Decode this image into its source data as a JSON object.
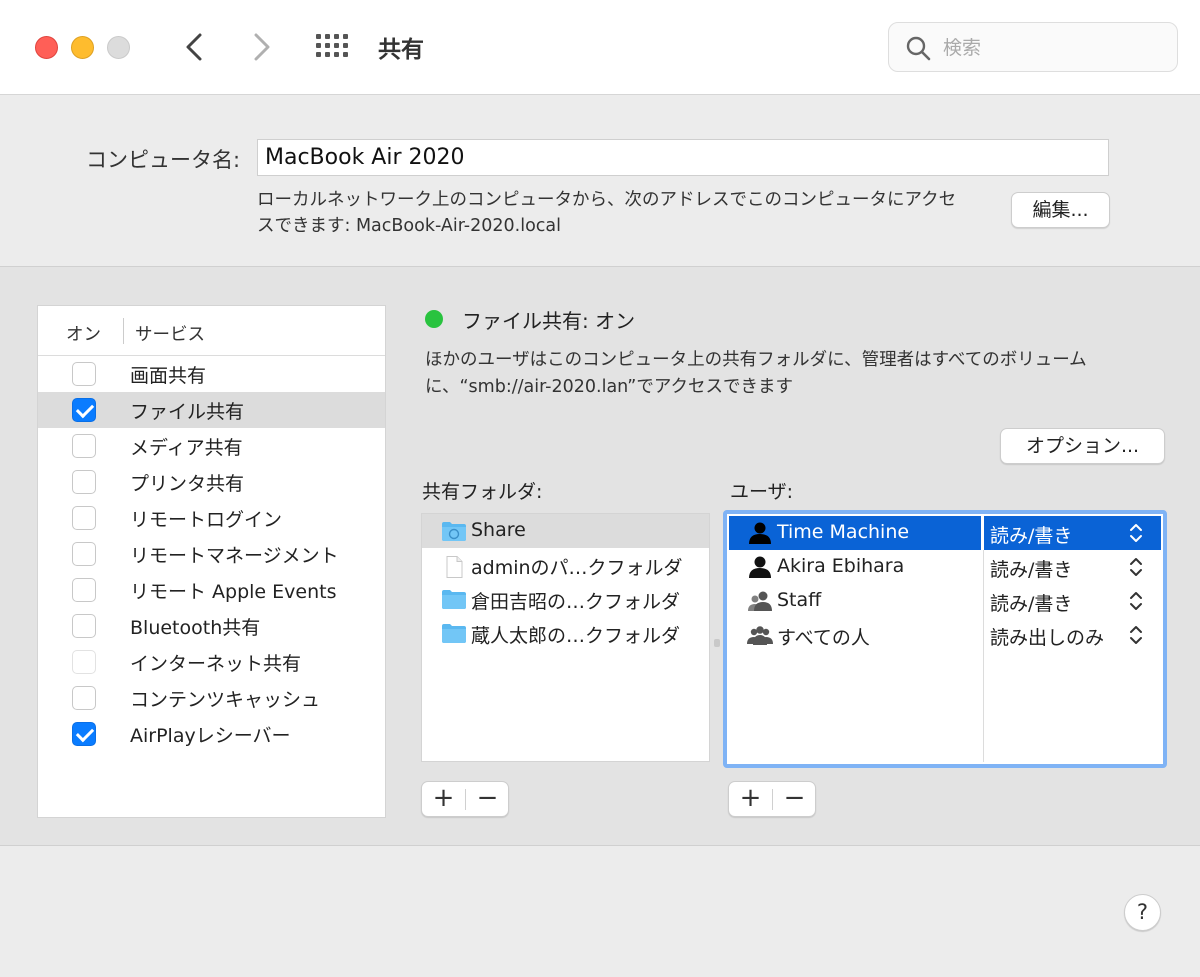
{
  "window": {
    "title": "共有",
    "search_placeholder": "検索"
  },
  "computer_name": {
    "label": "コンピュータ名:",
    "value": "MacBook Air 2020",
    "description_line1": "ローカルネットワーク上のコンピュータから、次のアドレスでこのコンピュータにアクセ",
    "description_line2": "スできます: MacBook-Air-2020.local",
    "edit_button": "編集..."
  },
  "services": {
    "header_on": "オン",
    "header_service": "サービス",
    "items": [
      {
        "label": "画面共有",
        "checked": false
      },
      {
        "label": "ファイル共有",
        "checked": true
      },
      {
        "label": "メディア共有",
        "checked": false
      },
      {
        "label": "プリンタ共有",
        "checked": false
      },
      {
        "label": "リモートログイン",
        "checked": false
      },
      {
        "label": "リモートマネージメント",
        "checked": false
      },
      {
        "label": "リモート Apple Events",
        "checked": false
      },
      {
        "label": "Bluetooth共有",
        "checked": false
      },
      {
        "label": "インターネット共有",
        "checked": false
      },
      {
        "label": "コンテンツキャッシュ",
        "checked": false
      },
      {
        "label": "AirPlayレシーバー",
        "checked": true
      }
    ]
  },
  "status": {
    "text": "ファイル共有: オン",
    "color": "#29c33f",
    "description_line1": "ほかのユーザはこのコンピュータ上の共有フォルダに、管理者はすべてのボリューム",
    "description_line2": "に、“smb://air-2020.lan”でアクセスできます",
    "options_button": "オプション..."
  },
  "shared_folders": {
    "label": "共有フォルダ:",
    "items": [
      {
        "name": "Share",
        "icon": "shared-folder-icon"
      },
      {
        "name": "adminのパ…クフォルダ",
        "icon": "document-icon"
      },
      {
        "name": "倉田吉昭の…クフォルダ",
        "icon": "folder-icon"
      },
      {
        "name": "蔵人太郎の…クフォルダ",
        "icon": "folder-icon"
      }
    ],
    "add": "+",
    "remove": "−"
  },
  "users": {
    "label": "ユーザ:",
    "items": [
      {
        "name": "Time Machine",
        "permission": "読み/書き",
        "icon": "user-icon"
      },
      {
        "name": "Akira Ebihara",
        "permission": "読み/書き",
        "icon": "user-icon"
      },
      {
        "name": "Staff",
        "permission": "読み/書き",
        "icon": "group-icon"
      },
      {
        "name": "すべての人",
        "permission": "読み出しのみ",
        "icon": "everyone-icon"
      }
    ],
    "add": "+",
    "remove": "−",
    "selected_color": "#0a63d6"
  },
  "help": "?"
}
